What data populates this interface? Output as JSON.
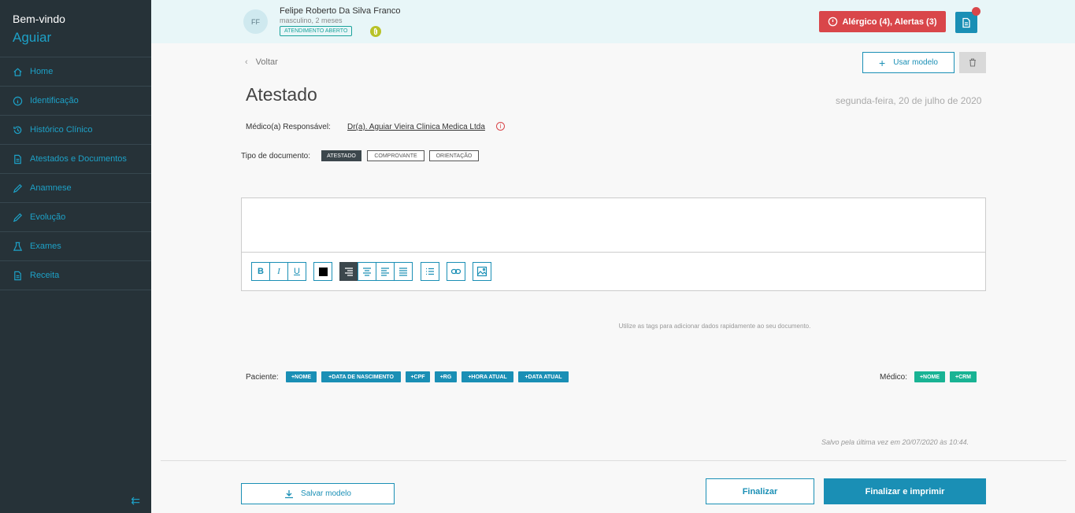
{
  "sidebar": {
    "welcome": "Bem-vindo",
    "user": "Aguiar",
    "items": [
      {
        "label": "Home",
        "icon": "home-icon"
      },
      {
        "label": "Identificação",
        "icon": "info-icon"
      },
      {
        "label": "Histórico Clínico",
        "icon": "history-icon"
      },
      {
        "label": "Atestados e Documentos",
        "icon": "document-icon"
      },
      {
        "label": "Anamnese",
        "icon": "pencil-icon"
      },
      {
        "label": "Evolução",
        "icon": "pencil-icon"
      },
      {
        "label": "Exames",
        "icon": "flask-icon"
      },
      {
        "label": "Receita",
        "icon": "document-icon"
      }
    ],
    "collapse_icon": "collapse-menu-icon"
  },
  "header": {
    "initials": "FF",
    "patient_name": "Felipe Roberto Da Silva Franco",
    "patient_info": "masculino, 2 meses",
    "status_badge": "ATENDIMENTO ABERTO",
    "alert_label": "Alérgico (4),  Alertas (3)"
  },
  "main": {
    "back_label": "Voltar",
    "use_model_label": "Usar modelo",
    "title": "Atestado",
    "date": "segunda-feira, 20 de julho de 2020",
    "responsible_label": "Médico(a) Responsável:",
    "responsible_name": "Dr(a). Aguiar Vieira Clinica Medica Ltda",
    "doc_type_label": "Tipo de documento:",
    "doc_types": [
      "ATESTADO",
      "COMPROVANTE",
      "ORIENTAÇÃO"
    ],
    "doc_type_selected": "ATESTADO",
    "hint": "Utilize as tags para adicionar dados rapidamente ao seu documento.",
    "patient_tags_label": "Paciente:",
    "patient_tags": [
      "+NOME",
      "+DATA DE NASCIMENTO",
      "+CPF",
      "+RG",
      "+HORA ATUAL",
      "+DATA ATUAL"
    ],
    "doctor_tags_label": "Médico:",
    "doctor_tags": [
      "+NOME",
      "+CRM"
    ],
    "saved_text": "Salvo pela última vez em 20/07/2020 às 10:44.",
    "save_model_label": "Salvar modelo",
    "finalize_label": "Finalizar",
    "finalize_print_label": "Finalizar e imprimir"
  },
  "toolbar": {
    "bold": "B",
    "italic": "I",
    "underline": "U"
  },
  "colors": {
    "accent": "#1a8fb5",
    "sidebar_bg": "#263238",
    "alert": "#d9464a",
    "tag_green": "#19b394"
  }
}
